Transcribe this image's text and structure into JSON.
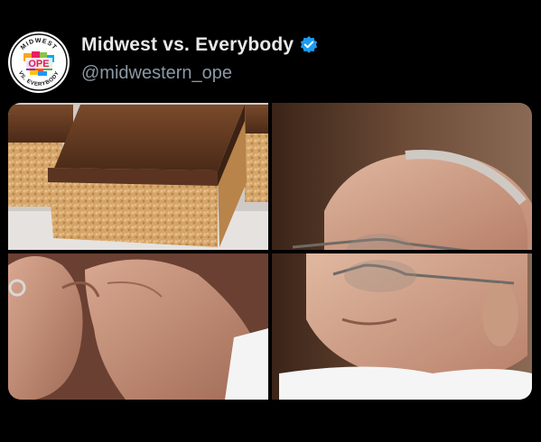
{
  "post": {
    "author": {
      "display_name": "Midwest vs. Everybody",
      "handle": "@midwestern_ope",
      "verified": true,
      "avatar_text_top": "MIDWEST",
      "avatar_text_center": "OPE",
      "avatar_text_bottom": "VS. EVERYBODY"
    },
    "media": {
      "tiles": [
        {
          "icon": "rice-krispie-bars-image"
        },
        {
          "icon": "man-with-glasses-image"
        },
        {
          "icon": "hands-image"
        },
        {
          "icon": "man-face-image"
        }
      ]
    }
  },
  "colors": {
    "background": "#000000",
    "name_text": "#e7e9ea",
    "handle_text": "#8b98a5",
    "verified_badge": "#1d9bf0"
  }
}
